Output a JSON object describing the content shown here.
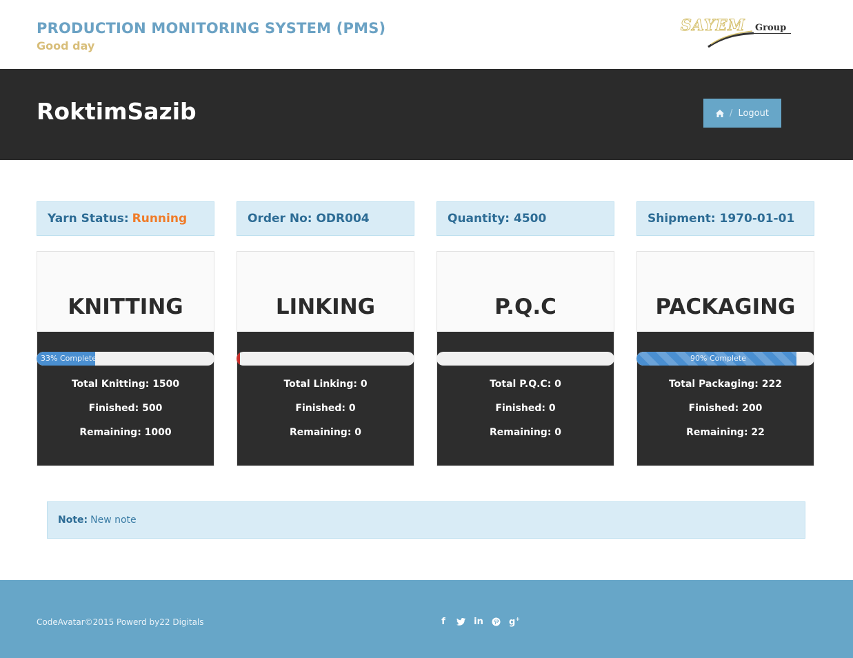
{
  "header": {
    "title": "PRODUCTION MONITORING SYSTEM (PMS)",
    "greeting": "Good day",
    "logo_text": "SAYEM",
    "logo_suffix": "Group"
  },
  "hero": {
    "user_name": "RoktimSazib",
    "breadcrumb": {
      "separator": "/",
      "logout_label": "Logout"
    }
  },
  "info": {
    "yarn_status_label": "Yarn Status:",
    "yarn_status_value": "Running",
    "order_label": "Order No: ODR004",
    "quantity_label": "Quantity: 4500",
    "shipment_label": "Shipment: 1970-01-01"
  },
  "cards": [
    {
      "title": "KNITTING",
      "progress": 33,
      "progress_text": "33% Complete",
      "total": "Total Knitting: 1500",
      "finished": "Finished: 500",
      "remaining": "Remaining: 1000"
    },
    {
      "title": "LINKING",
      "progress": 2,
      "progress_text": "",
      "total": "Total Linking: 0",
      "finished": "Finished: 0",
      "remaining": "Remaining: 0"
    },
    {
      "title": "P.Q.C",
      "progress": 0,
      "progress_text": "",
      "total": "Total P.Q.C: 0",
      "finished": "Finished: 0",
      "remaining": "Remaining: 0"
    },
    {
      "title": "PACKAGING",
      "progress": 90,
      "progress_text": "90% Complete",
      "total": "Total Packaging: 222",
      "finished": "Finished: 200",
      "remaining": "Remaining: 22"
    }
  ],
  "note": {
    "label": "Note:",
    "text": "New note"
  },
  "footer": {
    "copyright": "CodeAvatar©2015 Powerd by22 Digitals",
    "social_icons": [
      "facebook-icon",
      "twitter-icon",
      "linkedin-icon",
      "pinterest-icon",
      "google-plus-icon"
    ]
  },
  "colors": {
    "brand_blue": "#67a6c8",
    "accent_orange": "#f07c29",
    "dark": "#2b2b2b"
  }
}
